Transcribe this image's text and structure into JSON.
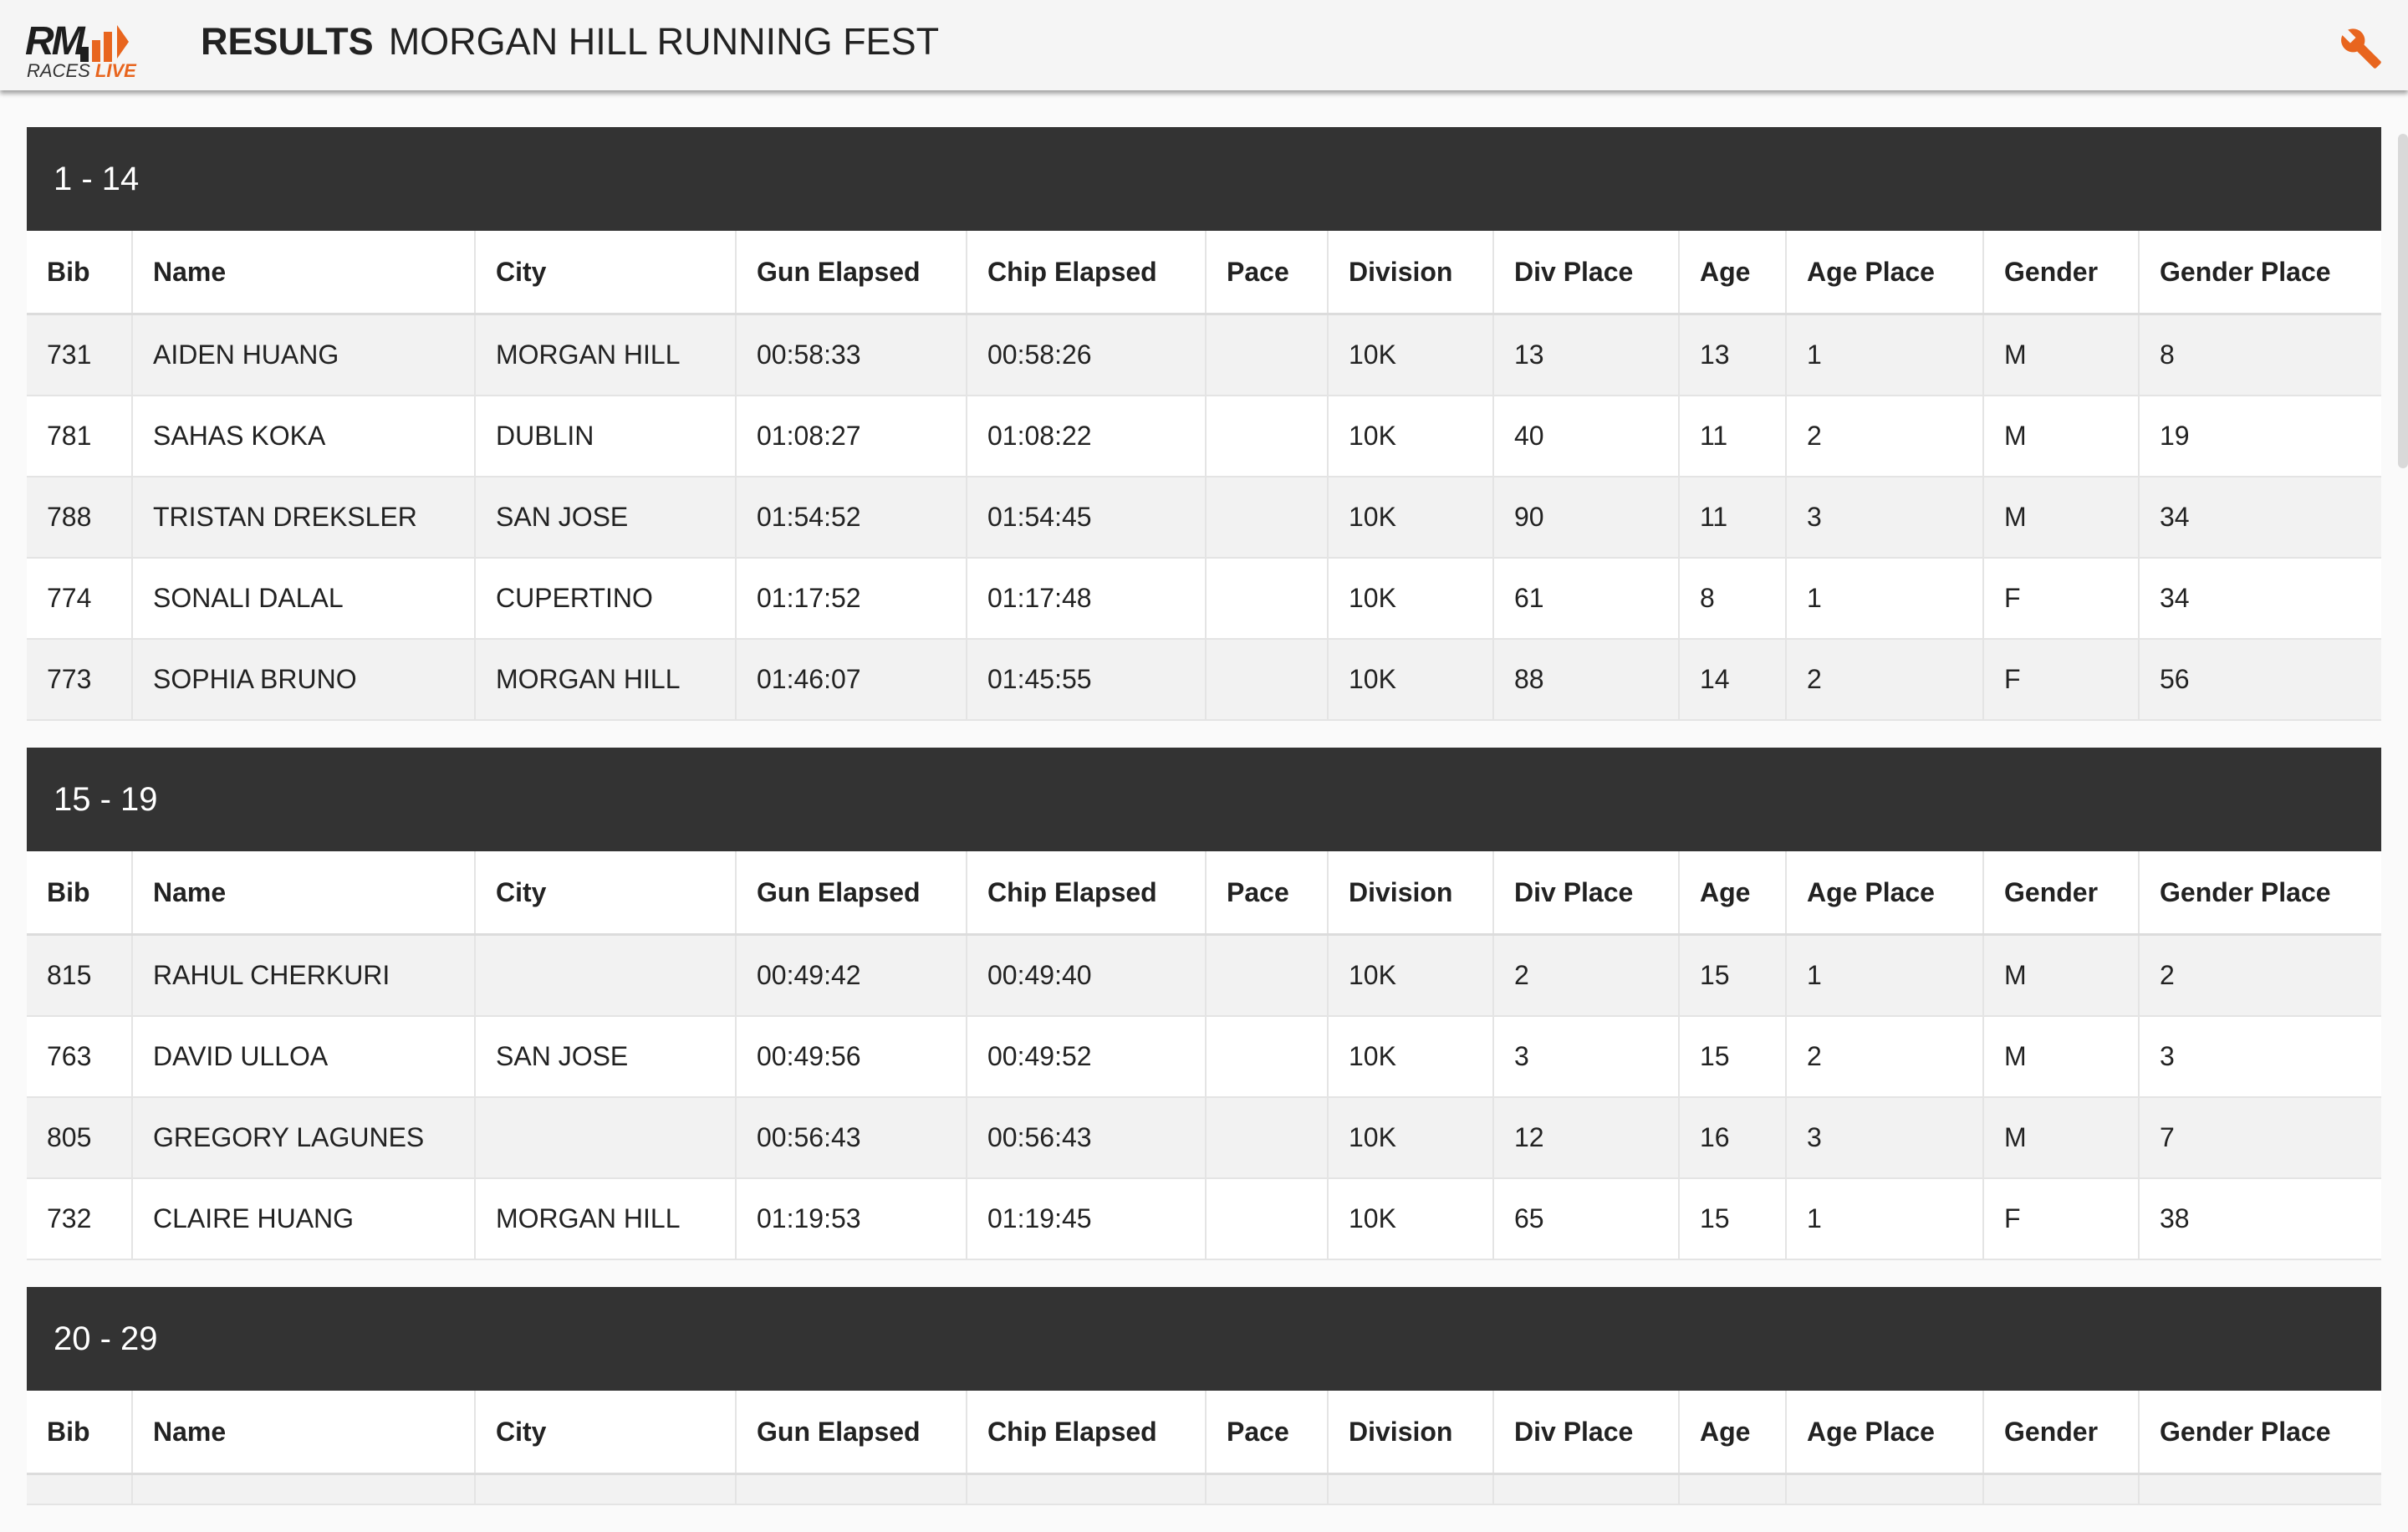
{
  "header": {
    "logo_rm": "RM",
    "logo_races": "RACES",
    "logo_live": "LIVE",
    "title_label": "RESULTS",
    "title_event": "MORGAN HILL RUNNING FEST",
    "settings_icon": "wrench-icon"
  },
  "colors": {
    "accent": "#e8651e",
    "group_header_bg": "#333333",
    "row_alt_bg": "#f2f2f2"
  },
  "columns": [
    "Bib",
    "Name",
    "City",
    "Gun Elapsed",
    "Chip Elapsed",
    "Pace",
    "Division",
    "Div Place",
    "Age",
    "Age Place",
    "Gender",
    "Gender Place"
  ],
  "groups": [
    {
      "title": "1 - 14",
      "rows": [
        [
          "731",
          "AIDEN HUANG",
          "MORGAN HILL",
          "00:58:33",
          "00:58:26",
          "",
          "10K",
          "13",
          "13",
          "1",
          "M",
          "8"
        ],
        [
          "781",
          "SAHAS KOKA",
          "DUBLIN",
          "01:08:27",
          "01:08:22",
          "",
          "10K",
          "40",
          "11",
          "2",
          "M",
          "19"
        ],
        [
          "788",
          "TRISTAN DREKSLER",
          "SAN JOSE",
          "01:54:52",
          "01:54:45",
          "",
          "10K",
          "90",
          "11",
          "3",
          "M",
          "34"
        ],
        [
          "774",
          "SONALI DALAL",
          "CUPERTINO",
          "01:17:52",
          "01:17:48",
          "",
          "10K",
          "61",
          "8",
          "1",
          "F",
          "34"
        ],
        [
          "773",
          "SOPHIA BRUNO",
          "MORGAN HILL",
          "01:46:07",
          "01:45:55",
          "",
          "10K",
          "88",
          "14",
          "2",
          "F",
          "56"
        ]
      ]
    },
    {
      "title": "15 - 19",
      "rows": [
        [
          "815",
          "RAHUL CHERKURI",
          "",
          "00:49:42",
          "00:49:40",
          "",
          "10K",
          "2",
          "15",
          "1",
          "M",
          "2"
        ],
        [
          "763",
          "DAVID ULLOA",
          "SAN JOSE",
          "00:49:56",
          "00:49:52",
          "",
          "10K",
          "3",
          "15",
          "2",
          "M",
          "3"
        ],
        [
          "805",
          "GREGORY LAGUNES",
          "",
          "00:56:43",
          "00:56:43",
          "",
          "10K",
          "12",
          "16",
          "3",
          "M",
          "7"
        ],
        [
          "732",
          "CLAIRE HUANG",
          "MORGAN HILL",
          "01:19:53",
          "01:19:45",
          "",
          "10K",
          "65",
          "15",
          "1",
          "F",
          "38"
        ]
      ]
    },
    {
      "title": "20 - 29",
      "rows": []
    }
  ]
}
